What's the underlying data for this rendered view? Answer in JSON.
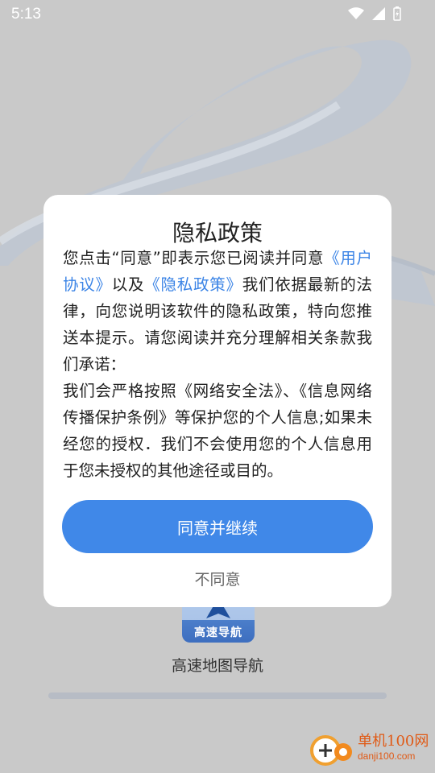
{
  "status_bar": {
    "time": "5:13"
  },
  "dialog": {
    "title": "隐私政策",
    "body_intro": "您点击“同意”即表示您已阅读并同意",
    "link_user_agreement": "《用户协议》",
    "body_and": "以及",
    "link_privacy_policy": "《隐私政策》",
    "body_rest": "我们依据最新的法律，向您说明该软件的隐私政策，特向您推送本提示。请您阅读并充分理解相关条款我们承诺：",
    "body_commitment": "我们会严格按照《网络安全法》、《信息网络传播保护条例》等保护您的个人信息;如果未经您的授权．我们不会使用您的个人信息用于您未授权的其他途径或目的。",
    "agree_label": "同意并继续",
    "disagree_label": "不同意"
  },
  "app": {
    "tile_label": "高速导航",
    "name": "高速地图导航"
  },
  "watermark": {
    "cn": "单机100网",
    "en": "danji100.com"
  },
  "colors": {
    "accent": "#4088e8",
    "link": "#3b84e6",
    "overlay_bg": "#c9c9c9"
  }
}
